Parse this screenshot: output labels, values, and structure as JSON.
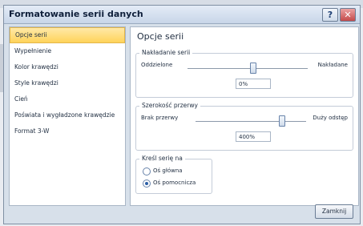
{
  "dialog": {
    "title": "Formatowanie serii danych",
    "help_label": "?",
    "close_label": "✕"
  },
  "nav": {
    "items": [
      {
        "label": "Opcje serii"
      },
      {
        "label": "Wypełnienie"
      },
      {
        "label": "Kolor krawędzi"
      },
      {
        "label": "Style krawędzi"
      },
      {
        "label": "Cień"
      },
      {
        "label": "Poświata i wygładzone krawędzie"
      },
      {
        "label": "Format 3-W"
      }
    ]
  },
  "content": {
    "section_title": "Opcje serii",
    "overlap": {
      "legend": "Nakładanie serii",
      "left_label": "Oddzielone",
      "right_label": "Nakładane",
      "value": "0%"
    },
    "gap": {
      "legend": "Szerokość przerwy",
      "left_label": "Brak przerwy",
      "right_label": "Duży odstęp",
      "value": "400%"
    },
    "plot_on": {
      "legend": "Kreśl serię na",
      "options": [
        {
          "label": "Oś główna",
          "selected": false
        },
        {
          "label": "Oś pomocnicza",
          "selected": true
        }
      ]
    }
  },
  "footer": {
    "close_button": "Zamknij"
  },
  "colors": {
    "selected_bg": "#ffd35a",
    "accent": "#2b5ea6"
  }
}
